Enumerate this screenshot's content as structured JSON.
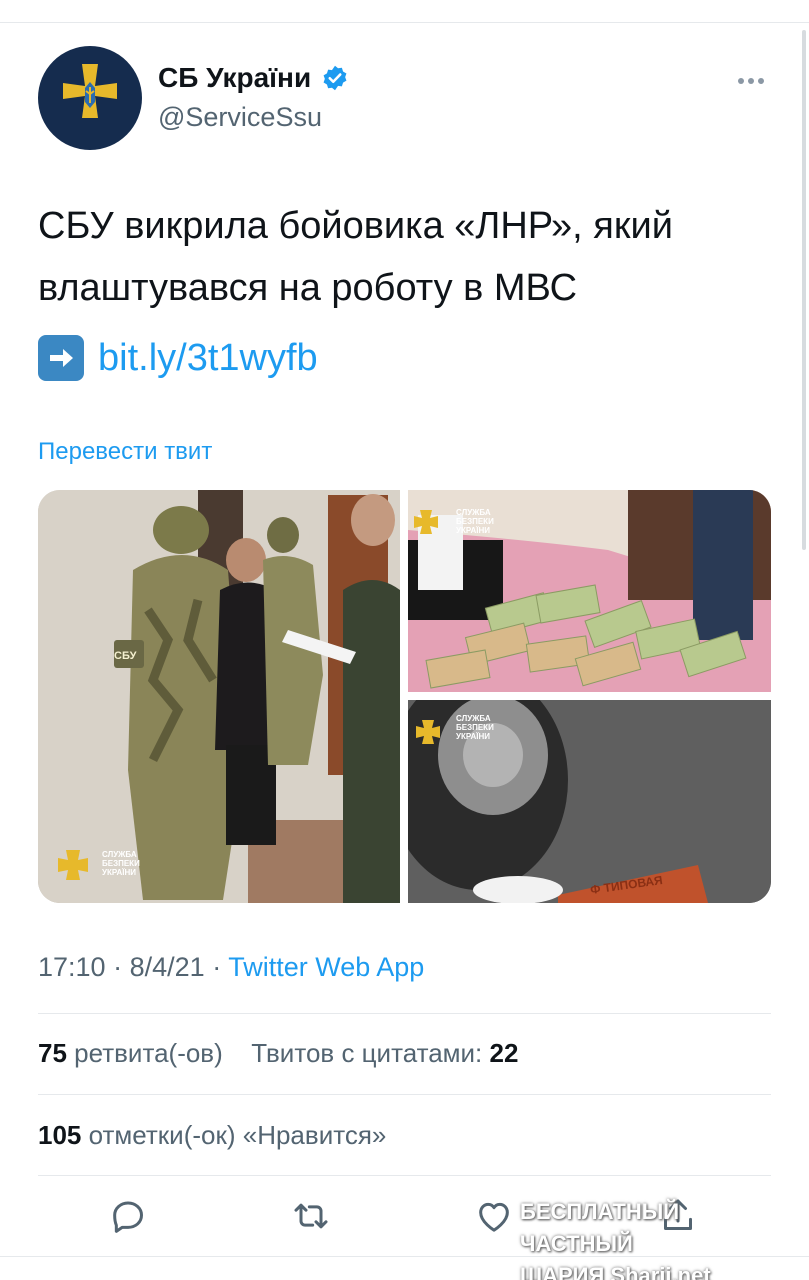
{
  "account": {
    "name": "СБ України",
    "handle": "@ServiceSsu"
  },
  "tweet": {
    "text": "СБУ викрила бойовика «ЛНР», який влаштувався на роботу в МВС",
    "link": "bit.ly/3t1wyfb",
    "translate_label": "Перевести твит"
  },
  "media": {
    "photo_badge": "СБУ",
    "watermark_lines": [
      "СЛУЖБА",
      "БЕЗПЕКИ",
      "УКРАЇНИ"
    ],
    "plate_text": "Ф ТИПОВАЯ"
  },
  "meta": {
    "time": "17:10",
    "date": "8/4/21",
    "source": "Twitter Web App"
  },
  "stats": {
    "retweets_count": "75",
    "retweets_label": "ретвита(-ов)",
    "quotes_label": "Твитов с цитатами:",
    "quotes_count": "22",
    "likes_count": "105",
    "likes_label": "отметки(-ок) «Нравится»"
  },
  "actions": [
    "reply-icon",
    "retweet-icon",
    "like-icon",
    "share-icon"
  ],
  "overlay_watermark": {
    "line1": "БЕСПЛАТНЫЙ ЧАСТНЫЙ",
    "line2": "ШАРИЯ Sharij.net"
  },
  "colors": {
    "accent": "#1d9bf0",
    "verified": "#1d9bf0",
    "avatar_bg": "#152c4e",
    "emblem": "#e7b92b"
  }
}
